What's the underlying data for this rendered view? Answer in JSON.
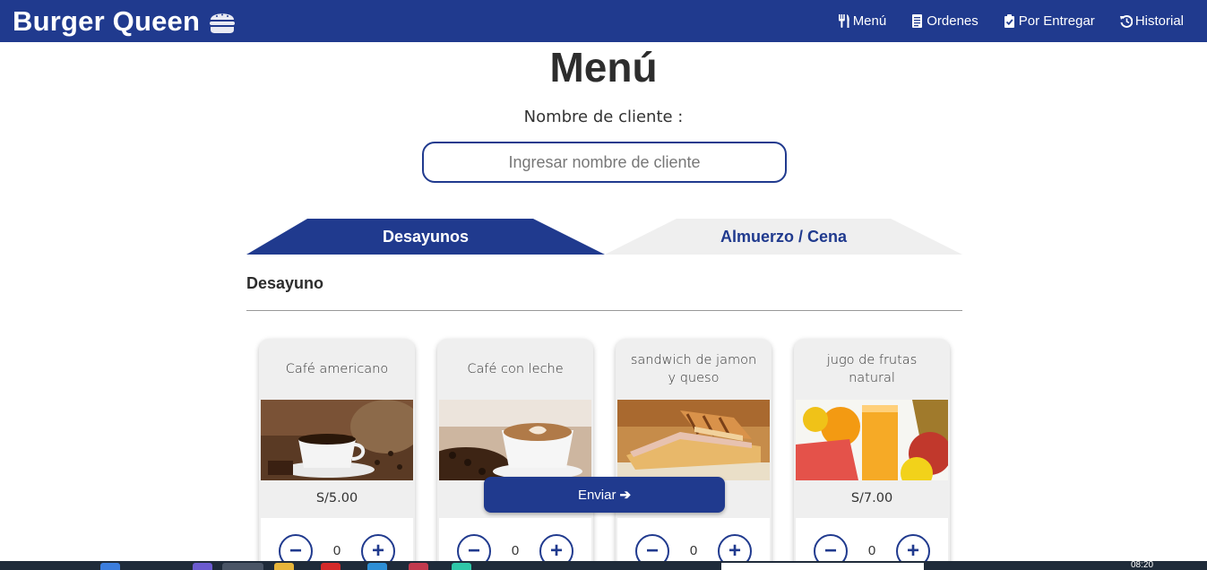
{
  "navbar": {
    "brand": "Burger Queen",
    "links": [
      {
        "label": "Menú",
        "icon": "utensils-icon"
      },
      {
        "label": "Ordenes",
        "icon": "receipt-icon"
      },
      {
        "label": "Por Entregar",
        "icon": "clipboard-check-icon"
      },
      {
        "label": "Historial",
        "icon": "history-icon"
      }
    ]
  },
  "page": {
    "title": "Menú",
    "client_label": "Nombre de cliente :",
    "client_placeholder": "Ingresar nombre de cliente",
    "client_value": ""
  },
  "tabs": [
    {
      "label": "Desayunos",
      "active": true
    },
    {
      "label": "Almuerzo / Cena",
      "active": false
    }
  ],
  "section": {
    "title": "Desayuno"
  },
  "products": [
    {
      "name": "Café americano",
      "price": "S/5.00",
      "qty": "0"
    },
    {
      "name": "Café con leche",
      "price": "",
      "qty": "0"
    },
    {
      "name": "sandwich de jamon y queso",
      "price": "",
      "qty": "0"
    },
    {
      "name": "jugo de frutas natural",
      "price": "S/7.00",
      "qty": "0"
    }
  ],
  "send_button": {
    "label": "Enviar"
  },
  "taskbar": {
    "clock": "08:20"
  },
  "colors": {
    "primary": "#203a8e",
    "card_bg": "#efefef"
  }
}
